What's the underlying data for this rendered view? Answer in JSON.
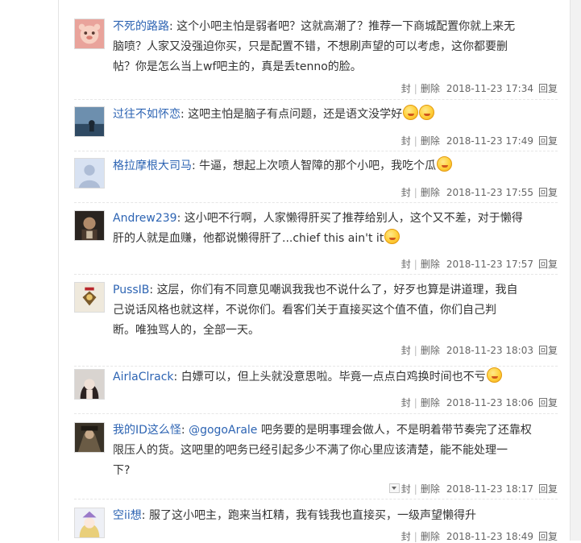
{
  "actions": {
    "block": "封",
    "delete": "删除",
    "reply": "回复",
    "divider": "|"
  },
  "replies": [
    {
      "user": "不死的路路",
      "colon": ":",
      "lines": [
        "这个小吧主怕是弱者吧？这就高潮了？推荐一下商城配置你就上来无",
        "脑喷？人家又没强迫你买，只是配置不错，不想刷声望的可以考虑，这你都要删",
        "帖？你是怎么当上wf吧主的，真是丢tenno的脸。"
      ],
      "time": "2018-11-23 17:34"
    },
    {
      "user": "过往不如怀恋",
      "colon": ":",
      "text": "这吧主怕是脑子有点问题，还是语文没学好",
      "time": "2018-11-23 17:49"
    },
    {
      "user": "格拉摩根大司马",
      "colon": ":",
      "text": "牛逼，想起上次喷人智障的那个小吧，我吃个瓜",
      "time": "2018-11-23 17:55"
    },
    {
      "user": "Andrew239",
      "colon": ":",
      "lines": [
        "这小吧不行啊，人家懒得肝买了推荐给别人，这个又不差，对于懒得",
        "肝的人就是血赚，他都说懒得肝了...chief this ain't it"
      ],
      "time": "2018-11-23 17:57"
    },
    {
      "user": "PussIB",
      "colon": ":",
      "lines": [
        "这层，你们有不同意见嘲讽我我也不说什么了，好歹也算是讲道理，我自",
        "己说话风格也就这样，不说你们。看客们关于直接买这个值不值，你们自己判",
        "断。唯独骂人的，全部一天。"
      ],
      "time": "2018-11-23 18:03"
    },
    {
      "user": "AirlaClrack",
      "colon": ":",
      "text": "白嫖可以，但上头就没意思啦。毕竟一点点白鸡换时间也不亏",
      "time": "2018-11-23 18:06"
    },
    {
      "user": "我的ID这么怪",
      "colon": ":",
      "mention": "@gogoArale",
      "lines": [
        " 吧务要的是明事理会做人，不是明着带节奏完了还靠权",
        "限压人的货。这吧里的吧务已经引起多少不满了你心里应该清楚，能不能处理一",
        "下?"
      ],
      "time": "2018-11-23 18:17"
    },
    {
      "user": "空ii想",
      "colon": ":",
      "text": "服了这小吧主，跑来当杠精，我有钱我也直接买，一级声望懒得升",
      "time": "2018-11-23 18:49"
    }
  ]
}
